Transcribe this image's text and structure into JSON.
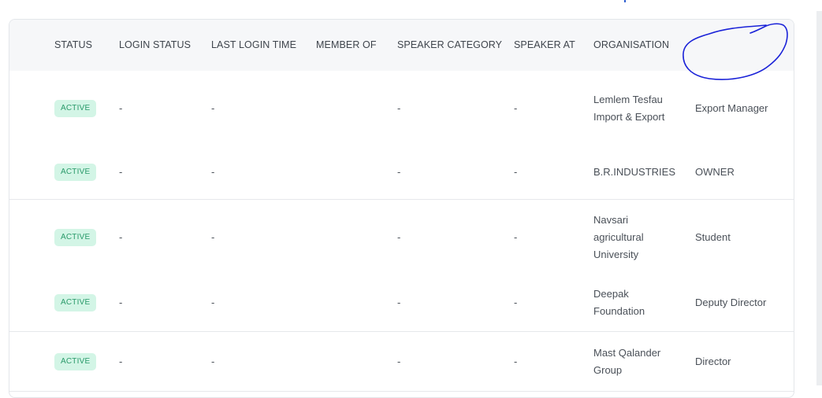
{
  "columns": [
    {
      "key": "status",
      "label": "STATUS"
    },
    {
      "key": "login_status",
      "label": "LOGIN STATUS"
    },
    {
      "key": "last_login_time",
      "label": "LAST LOGIN TIME"
    },
    {
      "key": "member_of",
      "label": "MEMBER OF"
    },
    {
      "key": "speaker_category",
      "label": "SPEAKER CATEGORY"
    },
    {
      "key": "speaker_at",
      "label": "SPEAKER AT"
    },
    {
      "key": "organisation",
      "label": "ORGANISATION"
    }
  ],
  "rows": [
    {
      "status": "ACTIVE",
      "login_status": "-",
      "last_login_time": "-",
      "member_of": "",
      "speaker_category": "-",
      "speaker_at": "-",
      "organisation": "Lemlem Tesfau Import & Export",
      "designation": "Export Manager"
    },
    {
      "status": "ACTIVE",
      "login_status": "-",
      "last_login_time": "-",
      "member_of": "",
      "speaker_category": "-",
      "speaker_at": "-",
      "organisation": "B.R.INDUSTRIES",
      "designation": "OWNER"
    },
    {
      "status": "ACTIVE",
      "login_status": "-",
      "last_login_time": "-",
      "member_of": "",
      "speaker_category": "-",
      "speaker_at": "-",
      "organisation": "Navsari agricultural University",
      "designation": "Student"
    },
    {
      "status": "ACTIVE",
      "login_status": "-",
      "last_login_time": "-",
      "member_of": "",
      "speaker_category": "-",
      "speaker_at": "-",
      "organisation": "Deepak Foundation",
      "designation": "Deputy Director"
    },
    {
      "status": "ACTIVE",
      "login_status": "-",
      "last_login_time": "-",
      "member_of": "",
      "speaker_category": "-",
      "speaker_at": "-",
      "organisation": "Mast Qalander Group",
      "designation": "Director"
    }
  ],
  "colors": {
    "badge_bg": "#d3f5e6",
    "badge_text": "#2a9a6a",
    "header_bg": "#f6f7f9",
    "annotation_ink": "#1a22d8"
  }
}
